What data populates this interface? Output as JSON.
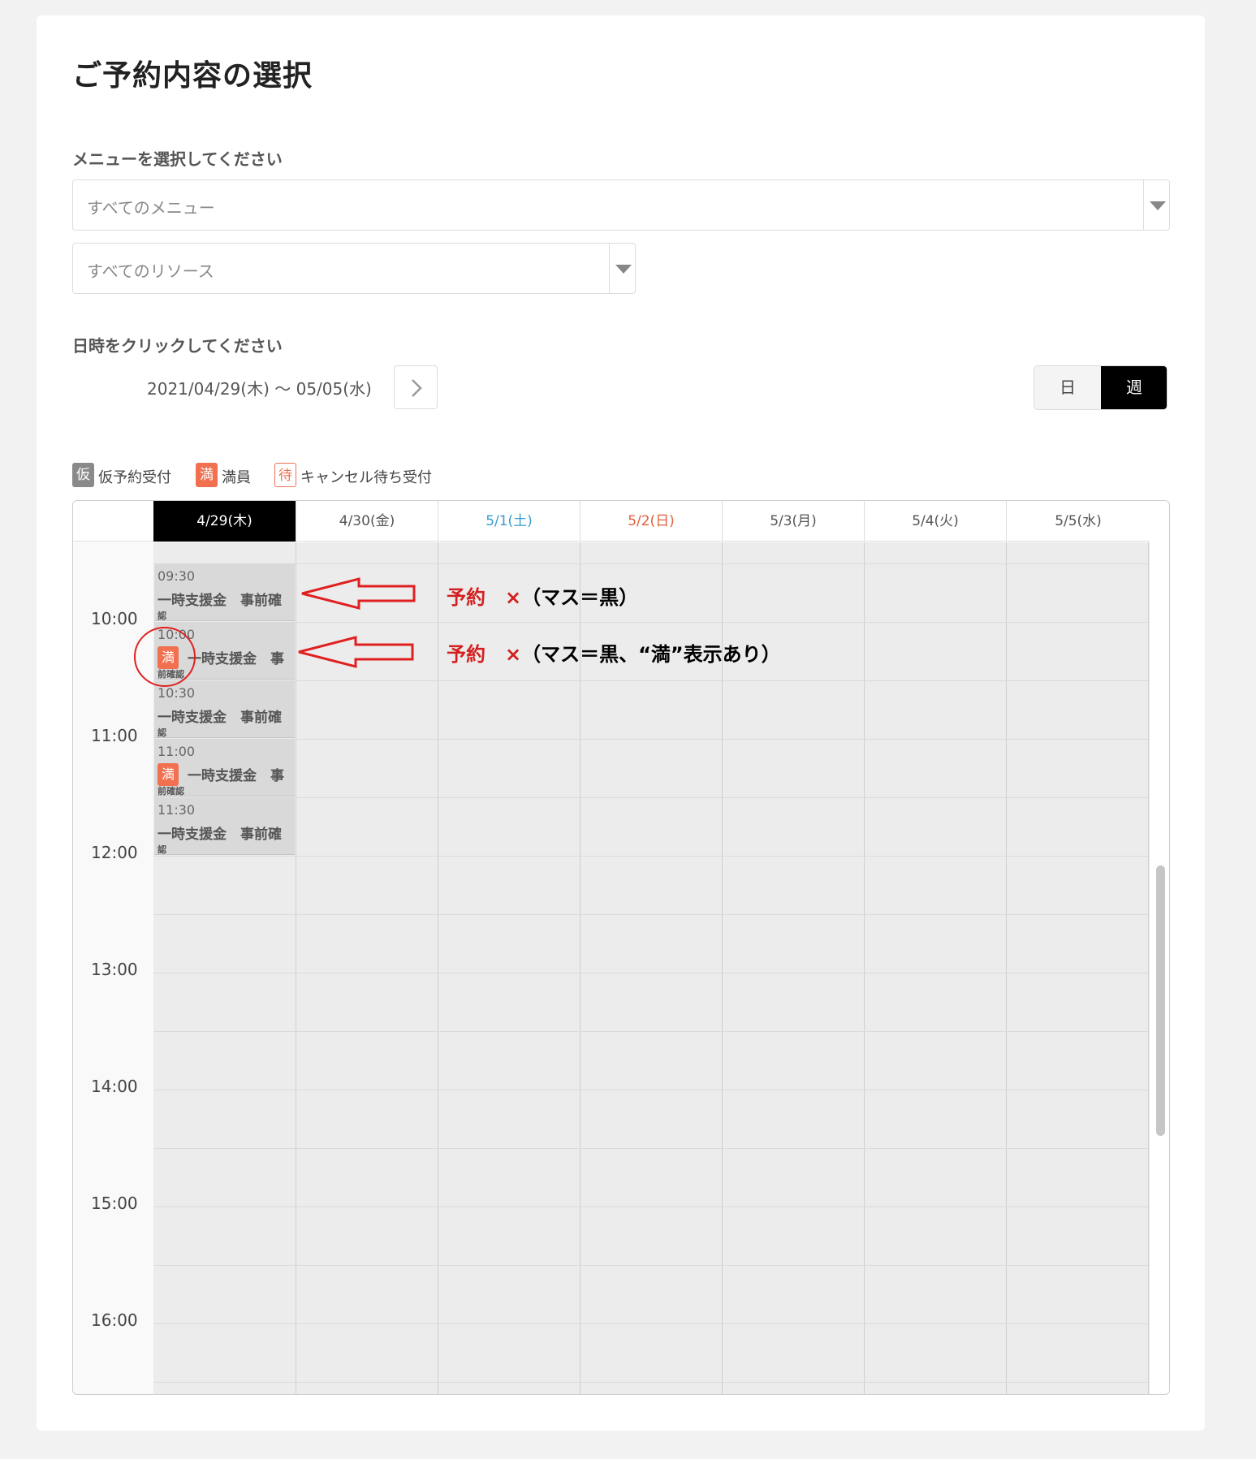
{
  "page": {
    "title": "ご予約内容の選択"
  },
  "menu_section": {
    "label": "メニューを選択してください",
    "menu_select": "すべてのメニュー",
    "resource_select": "すべてのリソース"
  },
  "datetime_section": {
    "label": "日時をクリックしてください",
    "date_range": "2021/04/29(木) ～ 05/05(水)",
    "view_toggle": {
      "day": "日",
      "week": "週",
      "selected": "week"
    }
  },
  "legend": [
    {
      "badge": "仮",
      "text": "仮予約受付",
      "color": "#8a8a8a"
    },
    {
      "badge": "満",
      "text": "満員",
      "color": "#f07050"
    },
    {
      "badge": "待",
      "text": "キャンセル待ち受付",
      "color": "#f07050"
    }
  ],
  "calendar": {
    "days": [
      {
        "label": "4/29(木)",
        "color": "#ffffff",
        "today": true
      },
      {
        "label": "4/30(金)",
        "color": "#555555"
      },
      {
        "label": "5/1(土)",
        "color": "#3a9ad0"
      },
      {
        "label": "5/2(日)",
        "color": "#e0603a"
      },
      {
        "label": "5/3(月)",
        "color": "#555555"
      },
      {
        "label": "5/4(火)",
        "color": "#555555"
      },
      {
        "label": "5/5(水)",
        "color": "#555555"
      }
    ],
    "times": [
      "10:00",
      "11:00",
      "12:00",
      "13:00",
      "14:00",
      "15:00",
      "16:00"
    ],
    "slots": [
      {
        "time": "09:30",
        "name": "一時支援金　事前確",
        "cont": "認",
        "full": false
      },
      {
        "time": "10:00",
        "name": "一時支援金　事",
        "cont": "前確認",
        "full": true,
        "full_badge": "満"
      },
      {
        "time": "10:30",
        "name": "一時支援金　事前確",
        "cont": "認",
        "full": false
      },
      {
        "time": "11:00",
        "name": "一時支援金　事",
        "cont": "前確認",
        "full": true,
        "full_badge": "満"
      },
      {
        "time": "11:30",
        "name": "一時支援金　事前確",
        "cont": "認",
        "full": false
      }
    ]
  },
  "annotations": [
    {
      "red": "予約　×",
      "black": "（マス＝黒）"
    },
    {
      "red": "予約　×",
      "black": "（マス＝黒、“満”表示あり）"
    }
  ]
}
